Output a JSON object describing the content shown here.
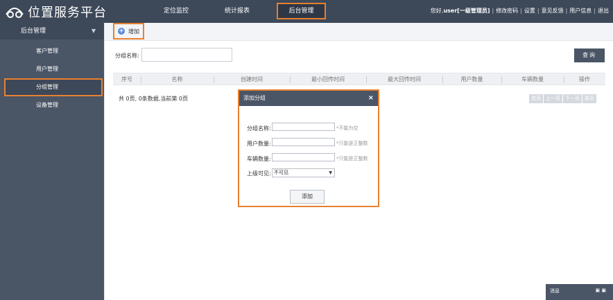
{
  "header": {
    "app_title": "位置服务平台",
    "nav": [
      "定位监控",
      "统计报表",
      "后台管理"
    ],
    "greeting_prefix": "您好,",
    "user_name": "user[一级管理员]",
    "links": [
      "修改密码",
      "设置",
      "意见反馈",
      "用户信息",
      "退出"
    ]
  },
  "sidebar": {
    "header": "后台管理",
    "items": [
      "客户管理",
      "用户管理",
      "分组管理",
      "设备管理"
    ]
  },
  "toolbar": {
    "add_label": "增加"
  },
  "search": {
    "label": "分组名称:",
    "value": "",
    "button": "查询"
  },
  "table": {
    "columns": [
      "序号",
      "名称",
      "创建时间",
      "最小回传时间",
      "最大回传时间",
      "用户数量",
      "车辆数量",
      "操作"
    ]
  },
  "paging": {
    "info": "共 0页, 0条数据,当前第 0页",
    "buttons": [
      "首页",
      "上一页",
      "下一页",
      "尾页"
    ]
  },
  "dialog": {
    "title": "添加分组",
    "close": "×",
    "fields": [
      {
        "label": "分组名称:",
        "hint": "*不能为空"
      },
      {
        "label": "用户数量:",
        "hint": "*只能是正整数"
      },
      {
        "label": "车辆数量:",
        "hint": "*只能是正整数"
      }
    ],
    "visibility_label": "上级可见:",
    "visibility_value": "不可见",
    "submit": "添加"
  },
  "status": {
    "message_label": "消息"
  },
  "colors": {
    "topbar": "#3d4859",
    "sidebar": "#4a5566",
    "highlight": "#e8802f"
  }
}
